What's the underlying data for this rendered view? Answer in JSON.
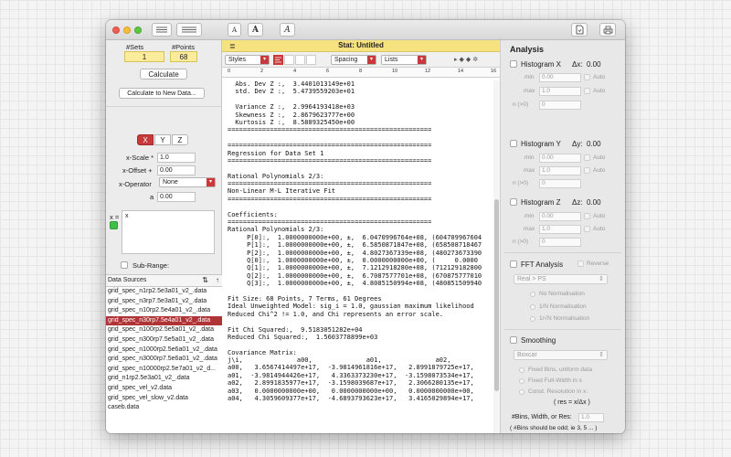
{
  "toolbar": {
    "font_small_label": "A",
    "font_bold_label": "A",
    "font_italic_label": "A"
  },
  "left": {
    "sets_label": "#Sets",
    "points_label": "#Points",
    "sets_value": "1",
    "points_value": "68",
    "calculate": "Calculate",
    "calculate_new": "Calculate to New Data...",
    "axes": [
      "X",
      "Y",
      "Z"
    ],
    "xscale_label": "x-Scale *",
    "xscale_value": "1.0",
    "xoffset_label": "x-Offset +",
    "xoffset_value": "0.00",
    "xoperator_label": "x-Operator",
    "xoperator_value": "None",
    "a_label": "a",
    "a_value": "0.00",
    "xeq_label": "x =",
    "xeq_value": "x",
    "subrange_label": "Sub-Range:"
  },
  "datasources": {
    "header": "Data Sources",
    "items": [
      "grid_spec_n1rp2.5e3a01_v2_.data",
      "grid_spec_n3rp7.5e3a01_v2_.data",
      "grid_spec_n10rp2.5e4a01_v2_.data",
      "grid_spec_n30rp7.5e4a01_v2_.data",
      "grid_spec_n100rp2.5e5a01_v2_.data",
      "grid_spec_n300rp7.5e5a01_v2_.data",
      "grid_spec_n1000rp2.5e6a01_v2_.data",
      "grid_spec_n3000rp7.5e6a01_v2_.data",
      "grid_spec_n10000rp2.5e7a01_v2_d...",
      "grid_n1rp2.5e3a01_v2_.data",
      "grid_spec_vel_v2.data",
      "grid_spec_vel_slow_v2.data",
      "caseb.data"
    ],
    "selected_index": 3
  },
  "center": {
    "title": "Stat: Untitled",
    "styles_label": "Styles",
    "spacing_label": "Spacing",
    "lists_label": "Lists",
    "ruler_marks": [
      "0",
      "2",
      "4",
      "6",
      "8",
      "10",
      "12",
      "14",
      "16"
    ],
    "text_lines": [
      "  Abs. Dev Z :,  3.4401013149e+01",
      "  std. Dev Z :,  5.4739559203e+01",
      "",
      "  Variance Z :,  2.9964193418e+03",
      "  Skewness Z :,  2.8679623777e+00",
      "  Kurtosis Z :,  8.5889325450e+00",
      "=====================================================",
      "",
      "=====================================================",
      "Regression for Data Set 1",
      "=====================================================",
      "",
      "Rational Polynomials 2/3:",
      "=====================================================",
      "Non-Linear M-L Iterative Fit",
      "=====================================================",
      "",
      "Coefficients:",
      "=====================================================",
      "Rational Polynomials 2/3:",
      "     P[0]:,  1.0000000000e+00, ±,  6.0470996764e+08, (604709967604",
      "     P[1]:,  1.0000000000e+00, ±,  6.5850871847e+08, (658508718467",
      "     P[2]:,  1.0000000000e+00, ±,  4.8027367339e+08, (480273673390",
      "     Q[0]:,  1.0000000000e+00, ±,  0.0000000000e+00, (     0.0000",
      "     Q[1]:,  1.0000000000e+00, ±,  7.1212918280e+08, (712129182800",
      "     Q[2]:,  1.0000000000e+00, ±,  6.7087577701e+08, (670875777010",
      "     Q[3]:,  1.0000000000e+00, ±,  4.8085150994e+08, (480851509940",
      "",
      "Fit Size: 68 Points, 7 Terms, 61 Degrees",
      "Ideal Unweighted Model: sig_i = 1.0, gaussian maximum likelihood",
      "Reduced Chi^2 != 1.0, and Chi represents an error scale.",
      "",
      "Fit Chi Squared:,  9.5183051282e+04",
      "Reduced Chi Squared:,  1.5603778899e+03",
      "",
      "Covariance Matrix:",
      "j\\i,              a00,              a01,              a02,",
      "a00,   3.6567414497e+17,  -3.9814961816e+17,   2.8991879725e+17,",
      "a01,  -3.9814944426e+17,   4.3363373230e+17,  -3.1598073534e+17,",
      "a02,   2.8991835977e+17,  -3.1598039687e+17,   2.3066280135e+17,",
      "a03,   0.0000000000e+00,   0.0000000000e+00,   0.0000000000e+00,",
      "a04,   4.3059609377e+17,  -4.6893793623e+17,   3.4165029894e+17,"
    ]
  },
  "analysis": {
    "title": "Analysis",
    "histx_label": "Histogram X",
    "histx_delta": "Δx:",
    "histx_delta_value": "0.00",
    "histy_label": "Histogram Y",
    "histy_delta": "Δy:",
    "histy_delta_value": "0.00",
    "histz_label": "Histogram Z",
    "histz_delta": "Δz:",
    "histz_delta_value": "0.00",
    "min_label": "min",
    "max_label": "max",
    "n_label": "n (>0)",
    "min_value": "0.00",
    "max_value": "1.0",
    "n_value": "0",
    "auto_label": "Auto",
    "fft_label": "FFT Analysis",
    "reverse_label": "Reverse",
    "fft_select": "Real > PS",
    "no_norm": "No Normalisation",
    "n_norm": "1/N Normalisation",
    "sqrtn_norm": "1/√N Normalisation",
    "smoothing_label": "Smoothing",
    "smoothing_select": "Boxcar",
    "fixed_bins": "Fixed Bins, uniform data",
    "fixed_fwhm": "Fixed Full-Width in x",
    "const_res": "Const. Resolution in x:",
    "res_formula": "( res = x/Δx )",
    "bins_label": "#Bins, Width, or Res:",
    "bins_value": "1.0",
    "bins_note": "( #Bins should be odd; ie 3, 5 ... )"
  }
}
